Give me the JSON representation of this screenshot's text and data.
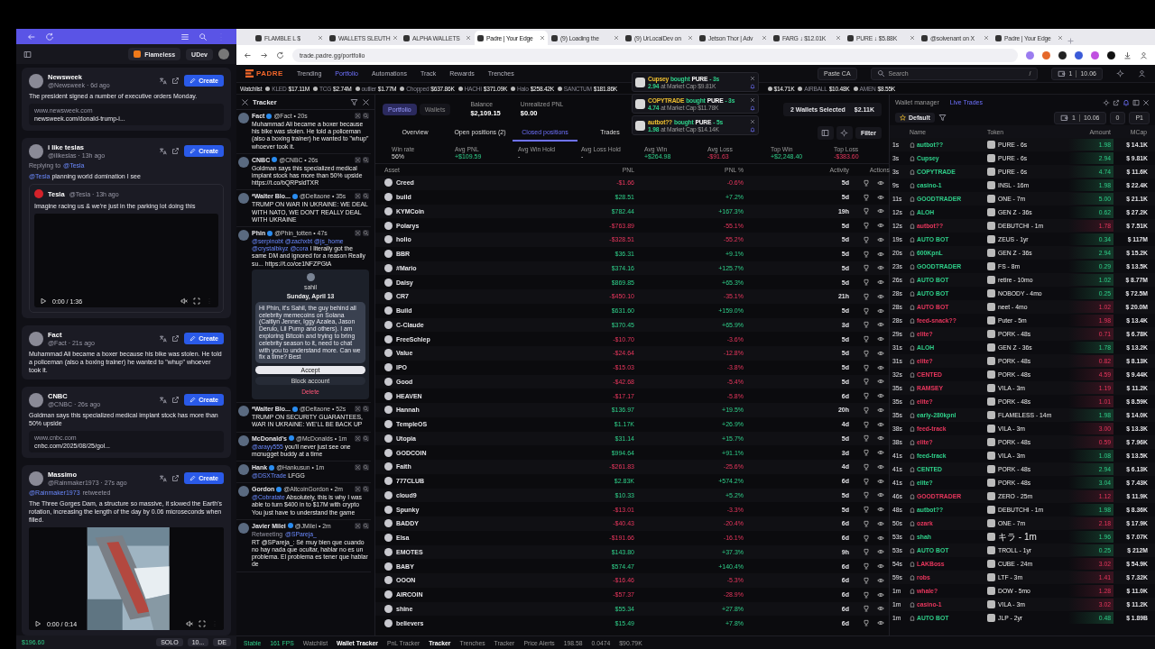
{
  "left_window": {
    "toolbar": {
      "project": "Flameless",
      "user": "UDev"
    },
    "feed": [
      {
        "name": "Newsweek",
        "handle": "@Newsweek · 6d ago",
        "button": "Create",
        "text": "The president signed a number of executive orders Monday.",
        "link": {
          "domain": "www.newsweek.com",
          "url": "newsweek.com/donald-trump-i..."
        }
      },
      {
        "name": "i like teslas",
        "handle": "@ilikeslas · 13h ago",
        "button": "Create",
        "context": [
          {
            "text": "Replying to",
            "kind": "label"
          },
          {
            "text": "@Tesla",
            "kind": "handle"
          }
        ],
        "mentions": [
          "@Tesla"
        ],
        "text": "planning world domination I see",
        "quote": {
          "name": "Tesla",
          "handle": "@Tesla · 13h ago",
          "text": "Imagine racing us & we're just in the parking lot doing this",
          "video": {
            "time": "0:00 / 1:36",
            "picture": false
          }
        }
      },
      {
        "name": "Fact",
        "handle": "@Fact · 21s ago",
        "button": "Create",
        "text": "Muhammad Ali became a boxer because his bike was stolen. He told a policeman (also a boxing trainer) he wanted to \"whup\" whoever took it."
      },
      {
        "name": "CNBC",
        "handle": "@CNBC · 26s ago",
        "button": "Create",
        "text": "Goldman says this specialized medical implant stock has more than 50% upside",
        "link": {
          "domain": "www.cnbc.com",
          "url": "cnbc.com/2025/08/25/gol..."
        }
      },
      {
        "name": "Massimo",
        "handle": "@Rainmaker1973 · 27s ago",
        "button": "Create",
        "context": [
          {
            "text": "@Rainmaker1973",
            "kind": "handle"
          },
          {
            "text": "retweeted",
            "kind": "label"
          }
        ],
        "text": "The Three Gorges Dam, a structure so massive, it slowed the Earth's rotation, increasing the length of the day by 0.06 microseconds when filled.",
        "video": {
          "time": "0:00 / 0:14",
          "picture": true
        }
      }
    ],
    "status_bar": {
      "balance": "$196.60",
      "mode": "SOLO",
      "amount": "10...",
      "lang": "DE"
    }
  },
  "browser": {
    "tabs": [
      {
        "title": "FLAMBLE L $",
        "selected": false
      },
      {
        "title": "WALLETS SLEUTH",
        "selected": false
      },
      {
        "title": "ALPHA WALLETS",
        "selected": false
      },
      {
        "title": "Padre | Your Edge",
        "selected": true
      },
      {
        "title": "(9) Loading the",
        "selected": false
      },
      {
        "title": "(9) UrLocalDev on",
        "selected": false
      },
      {
        "title": "Jetson Thor | Adv",
        "selected": false
      },
      {
        "title": "FARG ↓ $12.01K",
        "selected": false
      },
      {
        "title": "PURE ↓ $5.88K",
        "selected": false
      },
      {
        "title": "@solvenant on X",
        "selected": false
      },
      {
        "title": "Padre | Your Edge",
        "selected": false
      }
    ],
    "url": "trade.padre.gg/portfolio"
  },
  "app": {
    "logo": "PADRE",
    "nav": [
      {
        "label": "Trending",
        "selected": false
      },
      {
        "label": "Portfolio",
        "selected": true
      },
      {
        "label": "Automations",
        "selected": false
      },
      {
        "label": "Track",
        "selected": false
      },
      {
        "label": "Rewards",
        "selected": false
      },
      {
        "label": "Trenches",
        "selected": false
      }
    ],
    "paste": "Paste CA",
    "search": {
      "placeholder": "Search",
      "shortcut": "/"
    },
    "wallet_count": "1",
    "sol_balance": "10.06",
    "watchlist": {
      "label": "Watchlist",
      "items": [
        {
          "name": "KLED",
          "value": "$17.11M"
        },
        {
          "name": "TCG",
          "value": "$2.74M"
        },
        {
          "name": "outlier",
          "value": "$1.77M"
        },
        {
          "name": "Chopped",
          "value": "$637.86K"
        },
        {
          "name": "HACHI",
          "value": "$371.09K"
        },
        {
          "name": "Halo",
          "value": "$258.42K"
        },
        {
          "name": "SANCTUM",
          "value": "$181.86K"
        },
        {
          "value": "$14.71K"
        },
        {
          "name": "AIRBALL",
          "value": "$10.48K"
        },
        {
          "name": "AMEN",
          "value": "$8.55K"
        }
      ]
    },
    "notifications": [
      {
        "trader": "Cupsey",
        "action": "bought",
        "token": "PURE",
        "time": "- 3s",
        "amount": "2.94",
        "detail": "at Market Cap $9.81K"
      },
      {
        "trader": "COPYTRADE",
        "action": "bought",
        "token": "PURE",
        "time": "- 3s",
        "amount": "4.74",
        "detail": "at Market Cap $11.78K"
      },
      {
        "trader": "autbot??",
        "action": "bought",
        "token": "PURE",
        "time": "- 5s",
        "amount": "1.98",
        "detail": "at Market Cap $14.14K"
      }
    ],
    "tracker": {
      "title": "Tracker",
      "tweets": [
        {
          "name": "Fact",
          "handle": "@Fact • 20s",
          "text": "Muhammad Ali became a boxer because his bike was stolen. He told a policeman (also a boxing trainer) he wanted to \"whup\" whoever took it."
        },
        {
          "name": "CNBC",
          "handle": "@CNBC • 26s",
          "text": "Goldman says this specialized medical implant stock has more than 50% upside https://t.co/bQRPsldTXR"
        },
        {
          "name": "*Walter Blo...",
          "handle": "@Deltaone • 35s",
          "text": "TRUMP ON WAR IN UKRAINE: WE DEAL WITH NATO, WE DON'T REALLY DEAL WITH UKRAINE"
        },
        {
          "name": "Phin",
          "handle": "@Phin_totten • 47s",
          "mentions": [
            "@serpinobt",
            "@zachxbt",
            "@js_home",
            "@crystalbkyz",
            "@cora"
          ],
          "text": "I literally got the same DM and ignored for a reason Really su... https://t.co/ce1NFZPGtA",
          "embed": {
            "name": "sahil",
            "date": "Sunday, April 13",
            "message": "Hi Phin, it's Sahil, the guy behind all celebrity memecoins on Solana (Caitlyn Jenner, Iggy Azalea, Jason Derulo, Lil Pump and others). I am exploring Bitcoin and trying to bring celebrity season to it, need to chat with you to understand more. Can we fix a time? Best",
            "buttons": [
              {
                "label": "Accept",
                "kind": "accept"
              },
              {
                "label": "Block account",
                "kind": "block"
              },
              {
                "label": "Delete",
                "kind": "delete"
              }
            ]
          }
        },
        {
          "name": "*Walter Blo...",
          "handle": "@Deltaone • 52s",
          "text": "TRUMP ON SECURITY GUARANTEES, WAR IN UKRAINE: WE'LL BE BACK UP"
        },
        {
          "name": "McDonald's",
          "handle": "@McDonalds • 1m",
          "mentions": [
            "@arayy555"
          ],
          "text": "you'll never just see one mcnugget buddy at a time"
        },
        {
          "name": "Hank",
          "handle": "@Hankusun • 1m",
          "mentions": [
            "@DSXTrade"
          ],
          "text": "LFGG"
        },
        {
          "name": "Gordon",
          "handle": "@AltcoinGordon • 2m",
          "mentions": [
            "@Cobratate"
          ],
          "text": "Absolutely, this is why I was able to turn $400 in to $17M with crypto You just have to understand the game"
        },
        {
          "name": "Javier Milei",
          "handle": "@JMilei • 2m",
          "context": [
            {
              "text": "Retweeting",
              "kind": "label"
            },
            {
              "text": "@SPareja_",
              "kind": "handle"
            }
          ],
          "text": "RT @SPareja_: Sé muy bien que cuando no hay nada que ocultar, hablar no es un problema. El problema es tener que hablar de"
        }
      ]
    },
    "portfolio": {
      "views": [
        {
          "label": "Portfolio",
          "selected": true
        },
        {
          "label": "Wallets",
          "selected": false
        }
      ],
      "balance": {
        "label": "Balance",
        "value": "$2,109.15"
      },
      "unrealized": {
        "label": "Unrealized PNL",
        "value": "$0.00"
      },
      "wallets_selected": {
        "label": "2 Wallets Selected",
        "value": "$2.11K"
      },
      "tabs": [
        {
          "label": "Overview",
          "selected": false
        },
        {
          "label": "Open positions (2)",
          "selected": false
        },
        {
          "label": "Closed positions",
          "selected": true
        },
        {
          "label": "Trades",
          "selected": false
        }
      ],
      "filter": "Filter",
      "stats": [
        {
          "label": "Win rate",
          "value": "56%",
          "kind": "plain"
        },
        {
          "label": "Avg PNL",
          "value": "+$109.59",
          "kind": "gain"
        },
        {
          "label": "Avg Win Hold",
          "value": "-",
          "kind": "plain"
        },
        {
          "label": "Avg Loss Hold",
          "value": "-",
          "kind": "plain"
        },
        {
          "label": "Avg Win",
          "value": "+$264.98",
          "kind": "gain"
        },
        {
          "label": "Avg Loss",
          "value": "-$91.63",
          "kind": "loss"
        },
        {
          "label": "Top Win",
          "value": "+$2,248.40",
          "kind": "gain"
        },
        {
          "label": "Top Loss",
          "value": "-$383.60",
          "kind": "loss"
        }
      ],
      "table": {
        "columns": [
          "Asset",
          "PNL",
          "PNL %",
          "Activity",
          "Actions"
        ],
        "rows": [
          {
            "asset": "Creed",
            "pnl": "-$1.66",
            "pct": "-0.6%",
            "activity": "5d",
            "gain": false
          },
          {
            "asset": "build",
            "pnl": "$28.51",
            "pct": "+7.2%",
            "activity": "5d",
            "gain": true
          },
          {
            "asset": "KYMCoin",
            "pnl": "$782.44",
            "pct": "+167.3%",
            "activity": "19h",
            "gain": true
          },
          {
            "asset": "Polarys",
            "pnl": "-$763.89",
            "pct": "-55.1%",
            "activity": "5d",
            "gain": false
          },
          {
            "asset": "holio",
            "pnl": "-$328.51",
            "pct": "-55.2%",
            "activity": "5d",
            "gain": false
          },
          {
            "asset": "BBR",
            "pnl": "$36.31",
            "pct": "+9.1%",
            "activity": "5d",
            "gain": true
          },
          {
            "asset": "#Mario",
            "pnl": "$374.16",
            "pct": "+125.7%",
            "activity": "5d",
            "gain": true
          },
          {
            "asset": "Daisy",
            "pnl": "$869.85",
            "pct": "+65.3%",
            "activity": "5d",
            "gain": true
          },
          {
            "asset": "CR7",
            "pnl": "-$450.10",
            "pct": "-35.1%",
            "activity": "21h",
            "gain": false
          },
          {
            "asset": "Build",
            "pnl": "$631.60",
            "pct": "+159.0%",
            "activity": "5d",
            "gain": true
          },
          {
            "asset": "C-Claude",
            "pnl": "$370.45",
            "pct": "+65.9%",
            "activity": "3d",
            "gain": true
          },
          {
            "asset": "FreeSchlep",
            "pnl": "-$10.70",
            "pct": "-3.6%",
            "activity": "5d",
            "gain": false
          },
          {
            "asset": "Value",
            "pnl": "-$24.64",
            "pct": "-12.8%",
            "activity": "5d",
            "gain": false
          },
          {
            "asset": "IPO",
            "pnl": "-$15.03",
            "pct": "-3.8%",
            "activity": "5d",
            "gain": false
          },
          {
            "asset": "Good",
            "pnl": "-$42.68",
            "pct": "-5.4%",
            "activity": "5d",
            "gain": false
          },
          {
            "asset": "HEAVEN",
            "pnl": "-$17.17",
            "pct": "-5.8%",
            "activity": "6d",
            "gain": false
          },
          {
            "asset": "Hannah",
            "pnl": "$136.97",
            "pct": "+19.5%",
            "activity": "20h",
            "gain": true
          },
          {
            "asset": "TempleOS",
            "pnl": "$1.17K",
            "pct": "+26.9%",
            "activity": "4d",
            "gain": true
          },
          {
            "asset": "Utopia",
            "pnl": "$31.14",
            "pct": "+15.7%",
            "activity": "5d",
            "gain": true
          },
          {
            "asset": "GODCOIN",
            "pnl": "$994.64",
            "pct": "+91.1%",
            "activity": "3d",
            "gain": true
          },
          {
            "asset": "Faith",
            "pnl": "-$261.83",
            "pct": "-25.6%",
            "activity": "4d",
            "gain": false
          },
          {
            "asset": "777CLUB",
            "pnl": "$2.83K",
            "pct": "+574.2%",
            "activity": "6d",
            "gain": true
          },
          {
            "asset": "cloud9",
            "pnl": "$10.33",
            "pct": "+5.2%",
            "activity": "5d",
            "gain": true
          },
          {
            "asset": "Spunky",
            "pnl": "-$13.01",
            "pct": "-3.3%",
            "activity": "5d",
            "gain": false
          },
          {
            "asset": "BADDY",
            "pnl": "-$40.43",
            "pct": "-20.4%",
            "activity": "6d",
            "gain": false
          },
          {
            "asset": "Elsa",
            "pnl": "-$191.66",
            "pct": "-16.1%",
            "activity": "6d",
            "gain": false
          },
          {
            "asset": "EMOTES",
            "pnl": "$143.80",
            "pct": "+37.3%",
            "activity": "9h",
            "gain": true
          },
          {
            "asset": "BABY",
            "pnl": "$574.47",
            "pct": "+140.4%",
            "activity": "6d",
            "gain": true
          },
          {
            "asset": "OOON",
            "pnl": "-$16.46",
            "pct": "-5.3%",
            "activity": "6d",
            "gain": false
          },
          {
            "asset": "AIRCOIN",
            "pnl": "-$57.37",
            "pct": "-28.9%",
            "activity": "6d",
            "gain": false
          },
          {
            "asset": "shine",
            "pnl": "$55.34",
            "pct": "+27.8%",
            "activity": "6d",
            "gain": true
          },
          {
            "asset": "believers",
            "pnl": "$15.49",
            "pct": "+7.8%",
            "activity": "6d",
            "gain": true
          }
        ]
      }
    },
    "wallet_panel": {
      "tabs": [
        {
          "label": "Wallet manager",
          "selected": false
        },
        {
          "label": "Live Trades",
          "selected": true
        }
      ],
      "preset": "Default",
      "count": "1",
      "sol": "10.06",
      "min": "0",
      "page": "P1",
      "columns": [
        "Name",
        "Token",
        "Amount",
        "MCap"
      ],
      "rows": [
        {
          "time": "1s",
          "name": "autbot??",
          "token": "PURE - 6s",
          "amount": "1.98",
          "mcap": "$ 14.1K",
          "buy": true
        },
        {
          "time": "3s",
          "name": "Cupsey",
          "token": "PURE - 6s",
          "amount": "2.94",
          "mcap": "$ 9.81K",
          "buy": true
        },
        {
          "time": "3s",
          "name": "COPYTRADE",
          "token": "PURE - 6s",
          "amount": "4.74",
          "mcap": "$ 11.6K",
          "buy": true
        },
        {
          "time": "9s",
          "name": "casino-1",
          "token": "INSL - 16m",
          "amount": "1.98",
          "mcap": "$ 22.4K",
          "buy": true
        },
        {
          "time": "11s",
          "name": "GOODTRADER",
          "token": "ONE - 7m",
          "amount": "5.00",
          "mcap": "$ 21.1K",
          "buy": true
        },
        {
          "time": "12s",
          "name": "ALOH",
          "token": "GEN Z - 36s",
          "amount": "0.62",
          "mcap": "$ 27.2K",
          "buy": true
        },
        {
          "time": "12s",
          "name": "autbot??",
          "token": "DEBUTCHI - 1m",
          "amount": "1.78",
          "mcap": "$ 7.51K",
          "buy": false
        },
        {
          "time": "19s",
          "name": "AUTO BOT",
          "token": "ZEUS - 1yr",
          "amount": "0.34",
          "mcap": "$ 117M",
          "buy": true
        },
        {
          "time": "20s",
          "name": "600KpnL",
          "token": "GEN Z - 36s",
          "amount": "2.94",
          "mcap": "$ 15.2K",
          "buy": true
        },
        {
          "time": "23s",
          "name": "GOODTRADER",
          "token": "FS - 8m",
          "amount": "0.29",
          "mcap": "$ 13.5K",
          "buy": true
        },
        {
          "time": "26s",
          "name": "AUTO BOT",
          "token": "retire - 10mo",
          "amount": "1.02",
          "mcap": "$ 8.77M",
          "buy": true
        },
        {
          "time": "28s",
          "name": "AUTO BOT",
          "token": "NOBODY - 4mo",
          "amount": "0.25",
          "mcap": "$ 72.5M",
          "buy": true
        },
        {
          "time": "28s",
          "name": "AUTO BOT",
          "token": "neet - 4mo",
          "amount": "1.02",
          "mcap": "$ 20.0M",
          "buy": false
        },
        {
          "time": "28s",
          "name": "feed-snack??",
          "token": "Puter - 5m",
          "amount": "1.98",
          "mcap": "$ 13.4K",
          "buy": false
        },
        {
          "time": "29s",
          "name": "elite?",
          "token": "PORK - 48s",
          "amount": "0.71",
          "mcap": "$ 6.78K",
          "buy": false
        },
        {
          "time": "31s",
          "name": "ALOH",
          "token": "GEN Z - 36s",
          "amount": "1.78",
          "mcap": "$ 13.2K",
          "buy": true
        },
        {
          "time": "31s",
          "name": "elite?",
          "token": "PORK - 48s",
          "amount": "0.82",
          "mcap": "$ 8.13K",
          "buy": false
        },
        {
          "time": "32s",
          "name": "CENTED",
          "token": "PORK - 48s",
          "amount": "4.59",
          "mcap": "$ 9.44K",
          "buy": false
        },
        {
          "time": "35s",
          "name": "RAMSEY",
          "token": "VILA - 3m",
          "amount": "1.19",
          "mcap": "$ 11.2K",
          "buy": false
        },
        {
          "time": "35s",
          "name": "elite?",
          "token": "PORK - 48s",
          "amount": "1.01",
          "mcap": "$ 8.59K",
          "buy": false
        },
        {
          "time": "35s",
          "name": "early-280kpnl",
          "token": "FLAMELESS - 14m",
          "amount": "1.98",
          "mcap": "$ 14.0K",
          "buy": true
        },
        {
          "time": "38s",
          "name": "feed-track",
          "token": "VILA - 3m",
          "amount": "3.00",
          "mcap": "$ 13.3K",
          "buy": false
        },
        {
          "time": "38s",
          "name": "elite?",
          "token": "PORK - 48s",
          "amount": "0.59",
          "mcap": "$ 7.96K",
          "buy": false
        },
        {
          "time": "41s",
          "name": "feed-track",
          "token": "VILA - 3m",
          "amount": "1.08",
          "mcap": "$ 13.5K",
          "buy": true
        },
        {
          "time": "41s",
          "name": "CENTED",
          "token": "PORK - 48s",
          "amount": "2.94",
          "mcap": "$ 6.13K",
          "buy": true
        },
        {
          "time": "41s",
          "name": "elite?",
          "token": "PORK - 48s",
          "amount": "3.04",
          "mcap": "$ 7.43K",
          "buy": true
        },
        {
          "time": "46s",
          "name": "GOODTRADER",
          "token": "ZERO - 25m",
          "amount": "1.12",
          "mcap": "$ 11.9K",
          "buy": false
        },
        {
          "time": "48s",
          "name": "autbot??",
          "token": "DEBUTCHI - 1m",
          "amount": "1.98",
          "mcap": "$ 8.36K",
          "buy": true
        },
        {
          "time": "50s",
          "name": "ozark",
          "token": "ONE - 7m",
          "amount": "2.18",
          "mcap": "$ 17.9K",
          "buy": false
        },
        {
          "time": "53s",
          "name": "shah",
          "token": "キラ - 1m",
          "amount": "1.96",
          "mcap": "$ 7.07K",
          "buy": true
        },
        {
          "time": "53s",
          "name": "AUTO BOT",
          "token": "TROLL - 1yr",
          "amount": "0.25",
          "mcap": "$ 212M",
          "buy": true
        },
        {
          "time": "54s",
          "name": "LAKBoss",
          "token": "CUBE - 24m",
          "amount": "3.02",
          "mcap": "$ 54.9K",
          "buy": false
        },
        {
          "time": "59s",
          "name": "robs",
          "token": "LTF - 3m",
          "amount": "1.41",
          "mcap": "$ 7.32K",
          "buy": false
        },
        {
          "time": "1m",
          "name": "whale?",
          "token": "DOW - 5mo",
          "amount": "1.28",
          "mcap": "$ 11.0K",
          "buy": false
        },
        {
          "time": "1m",
          "name": "casino-1",
          "token": "VILA - 3m",
          "amount": "3.02",
          "mcap": "$ 11.2K",
          "buy": false
        },
        {
          "time": "1m",
          "name": "AUTO BOT",
          "token": "JLP - 2yr",
          "amount": "0.48",
          "mcap": "$ 1.89B",
          "buy": true
        }
      ]
    },
    "status_bar": [
      {
        "text": "Stable",
        "kind": "good"
      },
      {
        "text": "161 FPS",
        "kind": "good"
      },
      {
        "text": "Watchlist",
        "kind": "plain"
      },
      {
        "text": "Wallet Tracker",
        "kind": "active"
      },
      {
        "text": "PnL Tracker",
        "kind": "plain"
      },
      {
        "text": "Tracker",
        "kind": "active"
      },
      {
        "text": "Trenches",
        "kind": "plain"
      },
      {
        "text": "Tracker",
        "kind": "plain"
      },
      {
        "text": "Price Alerts",
        "kind": "plain"
      },
      {
        "text": "198.58",
        "kind": "plain"
      },
      {
        "text": "0.0474",
        "kind": "plain"
      },
      {
        "text": "$90.79K",
        "kind": "plain"
      }
    ]
  }
}
